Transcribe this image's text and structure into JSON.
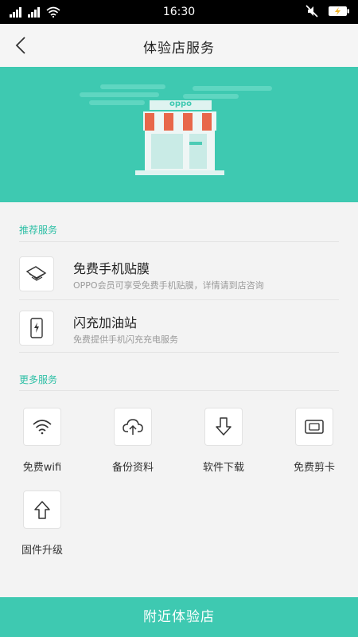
{
  "status_bar": {
    "time": "16:30",
    "signal_text_1": "ıl",
    "signal_text_2": "ıl",
    "icons": [
      "signal-icon",
      "signal-icon",
      "wifi-icon",
      "mute-icon",
      "battery-charging-icon"
    ]
  },
  "header": {
    "title": "体验店服务",
    "back_icon": "chevron-left-icon"
  },
  "banner": {
    "store_sign": "oppo",
    "colors": {
      "background": "#3ec9b1",
      "awning_red": "#e8674a",
      "store_body": "#eef6f5"
    }
  },
  "recommended": {
    "section_label": "推荐服务",
    "items": [
      {
        "title": "免费手机贴膜",
        "desc": "OPPO会员可享受免费手机贴膜，详情请到店咨询",
        "icon": "phone-film-icon"
      },
      {
        "title": "闪充加油站",
        "desc": "免费提供手机闪充充电服务",
        "icon": "phone-charge-icon"
      }
    ]
  },
  "more": {
    "section_label": "更多服务",
    "items": [
      {
        "label": "免费wifi",
        "icon": "wifi-icon"
      },
      {
        "label": "备份资料",
        "icon": "cloud-upload-icon"
      },
      {
        "label": "软件下载",
        "icon": "download-icon"
      },
      {
        "label": "免费剪卡",
        "icon": "sim-card-icon"
      },
      {
        "label": "固件升级",
        "icon": "upgrade-icon"
      }
    ]
  },
  "footer": {
    "button_label": "附近体验店"
  },
  "colors": {
    "accent": "#3ec9b1",
    "section_label": "#2dbfa5"
  }
}
